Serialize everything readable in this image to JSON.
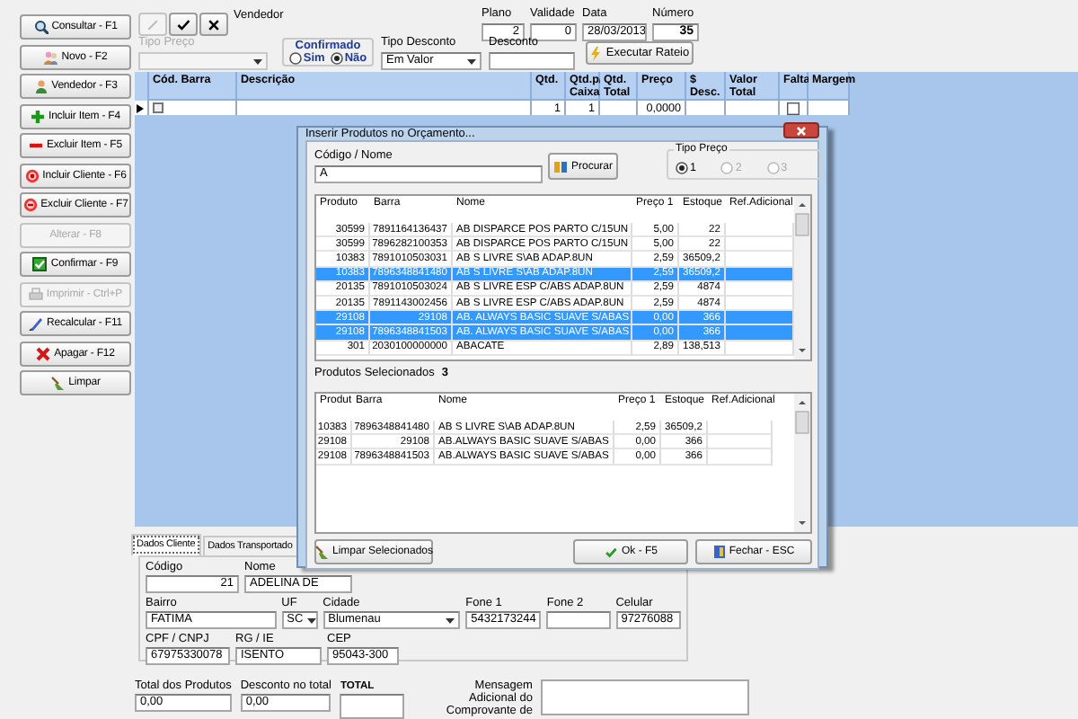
{
  "sidebar": {
    "buttons": [
      {
        "label": "Consultar - F1",
        "disabled": false
      },
      {
        "label": "Novo - F2",
        "disabled": false
      },
      {
        "label": "Vendedor - F3",
        "disabled": false
      },
      {
        "label": "Incluir Item - F4",
        "disabled": false
      },
      {
        "label": "Excluir Item - F5",
        "disabled": false
      },
      {
        "label": "Incluir Cliente - F6",
        "disabled": false
      },
      {
        "label": "Excluir Cliente - F7",
        "disabled": false
      },
      {
        "label": "Alterar - F8",
        "disabled": true
      },
      {
        "label": "Confirmar - F9",
        "disabled": false
      },
      {
        "label": "Imprimir - Ctrl+P",
        "disabled": true
      },
      {
        "label": "Recalcular - F11",
        "disabled": false
      },
      {
        "label": "Apagar - F12",
        "disabled": false
      },
      {
        "label": "Limpar",
        "disabled": false
      }
    ]
  },
  "toolbar": {
    "buttons": [
      {
        "disabled": true
      },
      {
        "disabled": false
      },
      {
        "disabled": false
      }
    ],
    "label": "Vendedor"
  },
  "header_fields": [
    {
      "label": "Plano",
      "value": "2",
      "bold": false
    },
    {
      "label": "Validade",
      "value": "0",
      "bold": false
    },
    {
      "label": "Data",
      "value": "28/03/2013",
      "bold": false
    },
    {
      "label": "Número",
      "value": "35",
      "bold": true
    }
  ],
  "tipo_preco": {
    "label": "Tipo Preço",
    "disabled": true
  },
  "confirmado": {
    "label": "Confirmado",
    "options": [
      {
        "label": "Sim",
        "selected": false
      },
      {
        "label": "Não",
        "selected": true
      }
    ]
  },
  "tipo_desconto": {
    "label": "Tipo Desconto",
    "value": "Em Valor"
  },
  "desconto": {
    "label": "Desconto"
  },
  "rateio_button": "Executar Rateio",
  "grid": {
    "columns": [
      "Cód. Barra",
      "Descrição",
      "Qtd.",
      "Qtd.p/ Caixa",
      "Qtd. Total",
      "Preço",
      "$ Desc.",
      "Valor Total",
      "Falta",
      "Margem"
    ],
    "row": {
      "qtd": "1",
      "qtd_caixa": "1",
      "preco": "0,0000",
      "falta": false
    }
  },
  "client_tabs": [
    {
      "label": "Dados Cliente",
      "selected": true
    },
    {
      "label": "Dados Transportado",
      "selected": false
    }
  ],
  "client": {
    "codigo": {
      "label": "Código",
      "value": "21"
    },
    "nome": {
      "label": "Nome",
      "value": "ADELINA DE"
    },
    "bairro": {
      "label": "Bairro",
      "value": "FATIMA"
    },
    "uf": {
      "label": "UF",
      "value": "SC"
    },
    "cidade": {
      "label": "Cidade",
      "value": "Blumenau"
    },
    "fone1": {
      "label": "Fone 1",
      "value": "5432173244"
    },
    "fone2": {
      "label": "Fone 2"
    },
    "celular": {
      "label": "Celular",
      "value": "97276088"
    },
    "cpf": {
      "label": "CPF / CNPJ",
      "value": "67975330078"
    },
    "rg": {
      "label": "RG / IE",
      "value": "ISENTO"
    },
    "cep": {
      "label": "CEP",
      "value": "95043-300"
    }
  },
  "totals": {
    "total_produtos": {
      "label": "Total dos Produtos",
      "value": "0,00"
    },
    "desconto_total": {
      "label": "Desconto no total",
      "value": "0,00"
    },
    "total": {
      "label": "TOTAL"
    },
    "mensagem": {
      "label": "Mensagem Adicional do Comprovante de"
    }
  },
  "dialog": {
    "title": "Inserir Produtos no Orçamento...",
    "search": {
      "label": "Código / Nome",
      "value": "A"
    },
    "search_button": "Procurar",
    "tipo_preco": {
      "label": "Tipo Preço",
      "options": [
        {
          "label": "1",
          "selected": true,
          "disabled": false
        },
        {
          "label": "2",
          "selected": false,
          "disabled": true
        },
        {
          "label": "3",
          "selected": false,
          "disabled": true
        }
      ]
    },
    "products": {
      "columns": [
        "Produto",
        "Barra",
        "Nome",
        "Preço 1",
        "Estoque",
        "Ref.Adicional"
      ],
      "rows": [
        {
          "cells": [
            "30599",
            "7891164136437",
            "AB DISPARCE POS PARTO C/15UN",
            "5,00",
            "22"
          ],
          "selected": false
        },
        {
          "cells": [
            "30599",
            "7896282100353",
            "AB DISPARCE POS PARTO C/15UN",
            "5,00",
            "22"
          ],
          "selected": false
        },
        {
          "cells": [
            "10383",
            "7891010503031",
            "AB S  LIVRE S\\AB ADAP.8UN",
            "2,59",
            "36509,2"
          ],
          "selected": false
        },
        {
          "cells": [
            "10383",
            "7896348841480",
            "AB S  LIVRE S\\AB ADAP.8UN",
            "2,59",
            "36509,2"
          ],
          "selected": true
        },
        {
          "cells": [
            "20135",
            "7891010503024",
            "AB S LIVRE ESP C/ABS ADAP.8UN",
            "2,59",
            "4874"
          ],
          "selected": false
        },
        {
          "cells": [
            "20135",
            "7891143002456",
            "AB S LIVRE ESP C/ABS ADAP.8UN",
            "2,59",
            "4874"
          ],
          "selected": false
        },
        {
          "cells": [
            "29108",
            "29108",
            "AB. ALWAYS BASIC SUAVE S/ABAS",
            "0,00",
            "366"
          ],
          "selected": true
        },
        {
          "cells": [
            "29108",
            "7896348841503",
            "AB. ALWAYS BASIC SUAVE S/ABAS",
            "0,00",
            "366"
          ],
          "selected": true
        },
        {
          "cells": [
            "301",
            "2030100000000",
            "ABACATE",
            "2,89",
            "138,513"
          ],
          "selected": false
        }
      ]
    },
    "selected_label": "Produtos Selecionados",
    "selected_count": "3",
    "selected_products": {
      "columns": [
        "Produt",
        "Barra",
        "Nome",
        "Preço 1",
        "Estoque",
        "Ref.Adicional"
      ],
      "rows": [
        {
          "cells": [
            "10383",
            "7896348841480",
            "AB S  LIVRE S\\AB ADAP.8UN",
            "2,59",
            "36509,2"
          ]
        },
        {
          "cells": [
            "29108",
            "29108",
            "AB.ALWAYS BASIC SUAVE S/ABAS",
            "0,00",
            "366"
          ]
        },
        {
          "cells": [
            "29108",
            "7896348841503",
            "AB.ALWAYS BASIC SUAVE S/ABAS",
            "0,00",
            "366"
          ]
        }
      ]
    },
    "buttons": [
      "Limpar Selecionados",
      "Ok - F5",
      "Fechar - ESC"
    ]
  }
}
